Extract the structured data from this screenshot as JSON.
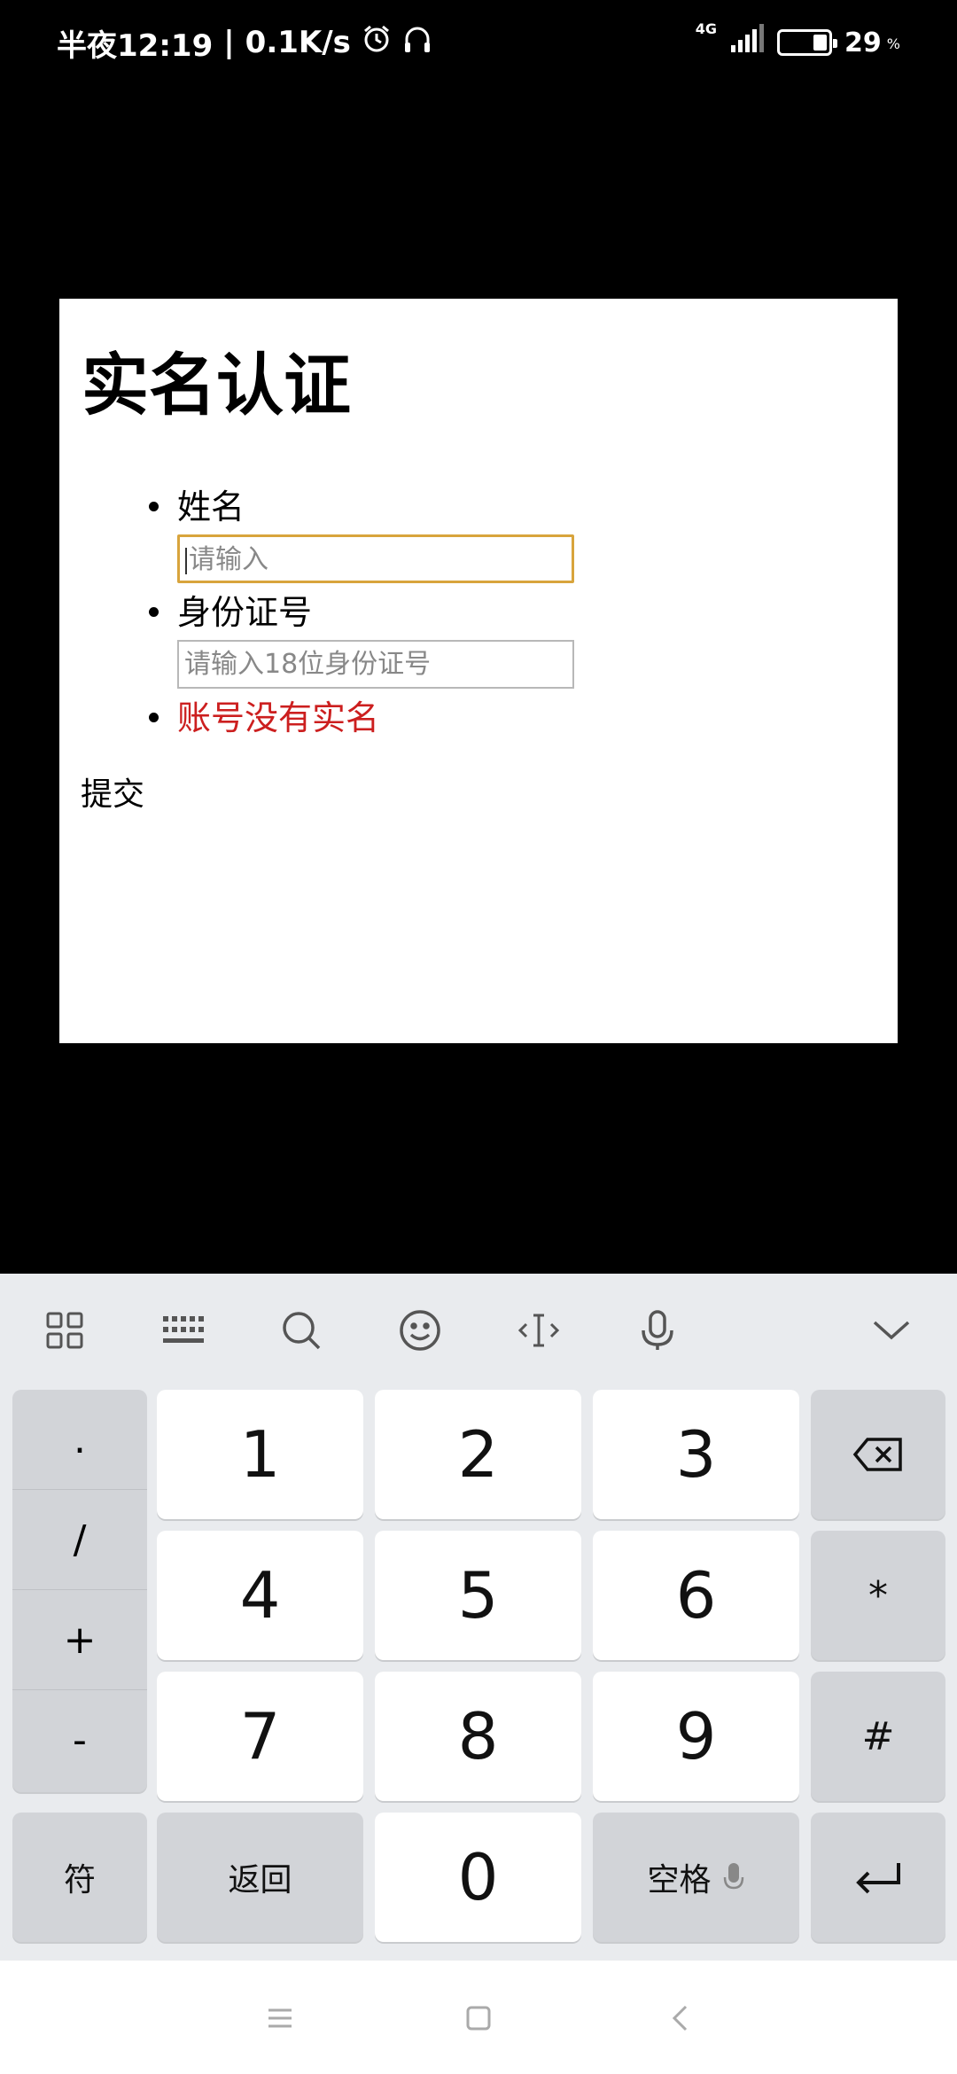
{
  "status_bar": {
    "time": "半夜12:19",
    "network_speed": "0.1K/s",
    "network_type": "4G",
    "battery_percent": "29",
    "battery_suffix": "%",
    "icons": [
      "alarm-icon",
      "headphones-icon",
      "signal-icon",
      "battery-icon"
    ]
  },
  "page": {
    "title": "实名认证",
    "fields": [
      {
        "label": "姓名",
        "placeholder": "请输入",
        "focused": true
      },
      {
        "label": "身份证号",
        "placeholder": "请输入18位身份证号",
        "focused": false
      }
    ],
    "error_message": "账号没有实名",
    "submit_label": "提交",
    "colors": {
      "error": "#cc1f1f",
      "focus_border": "#d8a43c"
    }
  },
  "keyboard": {
    "toolbar_icons": [
      "apps-grid-icon",
      "keyboard-icon",
      "search-icon",
      "emoji-icon",
      "cursor-move-icon",
      "microphone-icon",
      "collapse-chevron-icon"
    ],
    "symbols": [
      ".",
      "/",
      "+",
      "-"
    ],
    "digits": [
      "1",
      "2",
      "3",
      "4",
      "5",
      "6",
      "7",
      "8",
      "9",
      "0"
    ],
    "backspace_icon": "backspace-icon",
    "star": "*",
    "hash": "#",
    "symbols_key": "符",
    "back_key": "返回",
    "space_key": "空格",
    "enter_icon": "enter-icon"
  },
  "nav_bar": {
    "icons": [
      "menu-icon",
      "home-icon",
      "back-icon"
    ]
  }
}
